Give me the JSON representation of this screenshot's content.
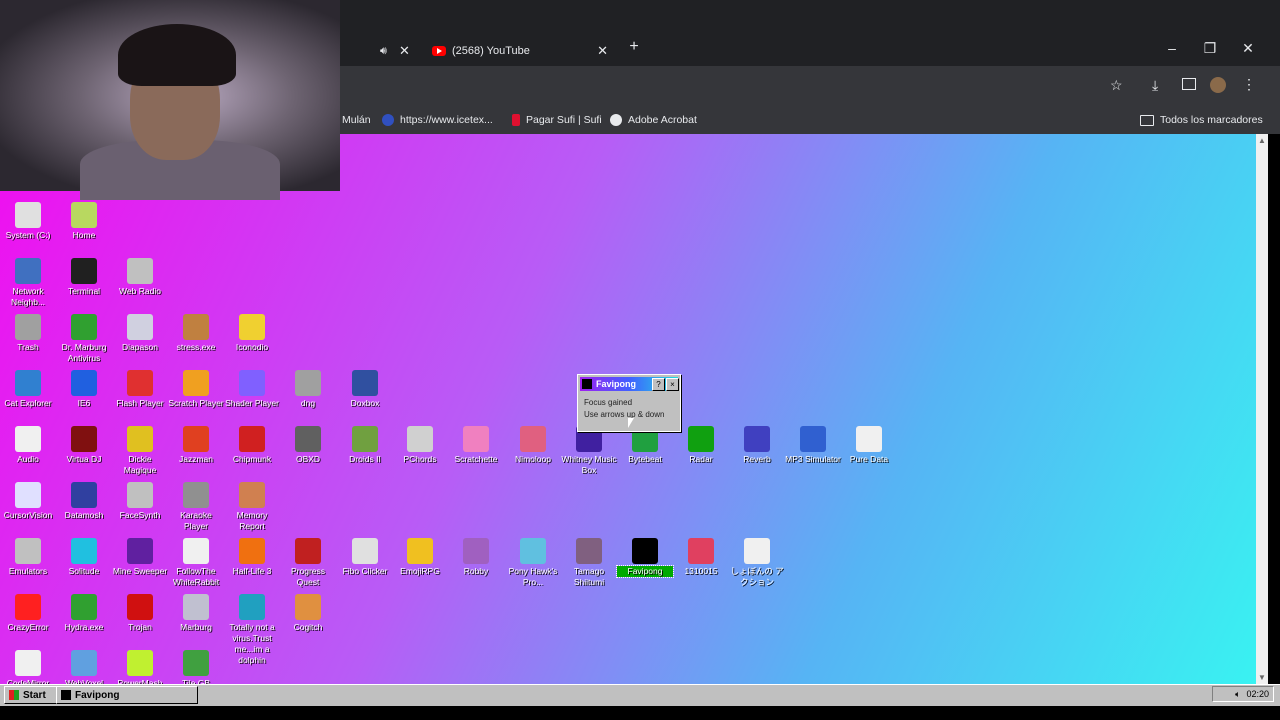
{
  "browser": {
    "tabs": [
      {
        "label": ""
      },
      {
        "label": "(2568) YouTube"
      }
    ],
    "new_tab_symbol": "+",
    "bookmarks": [
      {
        "label": "Mulán"
      },
      {
        "label": "https://www.icetex..."
      },
      {
        "label": "Pagar Sufi | Sufi"
      },
      {
        "label": "Adobe Acrobat"
      }
    ],
    "all_bookmarks_label": "Todos los marcadores"
  },
  "desktop": {
    "icons": [
      {
        "label": "System (C:)",
        "color": "#e0e0e0"
      },
      {
        "label": "Home",
        "color": "#b8d860"
      },
      {
        "label": "Network Neighb...",
        "color": "#4070c0"
      },
      {
        "label": "Terminal",
        "color": "#202020"
      },
      {
        "label": "Web Radio",
        "color": "#c0c0c0"
      },
      {
        "label": "Trash",
        "color": "#a0a0a0"
      },
      {
        "label": "Dr. Marburg Antivirus",
        "color": "#30a030"
      },
      {
        "label": "Diapason",
        "color": "#d0d0e0"
      },
      {
        "label": "stress.exe",
        "color": "#c08040"
      },
      {
        "label": "Iconodio",
        "color": "#f0d030"
      },
      {
        "label": "Cat Explorer",
        "color": "#3080d0"
      },
      {
        "label": "IE6",
        "color": "#2060e0"
      },
      {
        "label": "Flash Player",
        "color": "#e03030"
      },
      {
        "label": "Scratch Player",
        "color": "#f0a020"
      },
      {
        "label": "Shader Player",
        "color": "#8060ff"
      },
      {
        "label": "dng",
        "color": "#a0a0a0"
      },
      {
        "label": "Doxbox",
        "color": "#3050a0"
      },
      {
        "label": "Audio",
        "color": "#f0f0f0"
      },
      {
        "label": "Virtua DJ",
        "color": "#801010"
      },
      {
        "label": "Dickie Magique",
        "color": "#e0c020"
      },
      {
        "label": "Jazzman",
        "color": "#e04020"
      },
      {
        "label": "Chipmunk",
        "color": "#d02020"
      },
      {
        "label": "OBXD",
        "color": "#606060"
      },
      {
        "label": "Droids II",
        "color": "#70a040"
      },
      {
        "label": "PChords",
        "color": "#d0d0d0"
      },
      {
        "label": "Scratchette",
        "color": "#f080c0"
      },
      {
        "label": "Nimoloop",
        "color": "#e06080"
      },
      {
        "label": "Whitney Music Box",
        "color": "#4020a0"
      },
      {
        "label": "Bytebeat",
        "color": "#20a040"
      },
      {
        "label": "Radar",
        "color": "#10a010"
      },
      {
        "label": "Reverb",
        "color": "#4040c0"
      },
      {
        "label": "MP3 Simulator",
        "color": "#3060d0"
      },
      {
        "label": "Pure Data",
        "color": "#f0f0f0"
      },
      {
        "label": "CursorVision",
        "color": "#e0e0ff"
      },
      {
        "label": "Datamosh",
        "color": "#3040a0"
      },
      {
        "label": "FaceSynth",
        "color": "#c0c0c0"
      },
      {
        "label": "Karaoke Player",
        "color": "#909090"
      },
      {
        "label": "Memory Report",
        "color": "#d08050"
      },
      {
        "label": "Emulators",
        "color": "#c0c0c0"
      },
      {
        "label": "Solitude",
        "color": "#20c0e0"
      },
      {
        "label": "Mine Sweeper",
        "color": "#6020a0"
      },
      {
        "label": "FollowThe WhiteRabbit",
        "color": "#f0f0f0"
      },
      {
        "label": "Half-Life 3",
        "color": "#f07010"
      },
      {
        "label": "Progress Quest",
        "color": "#c02020"
      },
      {
        "label": "Fibo Clicker",
        "color": "#e0e0e0"
      },
      {
        "label": "EmojiRPG",
        "color": "#f0c020"
      },
      {
        "label": "Robby",
        "color": "#a060c0"
      },
      {
        "label": "Pony Hawk's Pro...",
        "color": "#60c0e0"
      },
      {
        "label": "Tamago Shiitumi",
        "color": "#806080"
      },
      {
        "label": "Favipong",
        "color": "#000000"
      },
      {
        "label": "1310015",
        "color": "#e04060"
      },
      {
        "label": "しょぼんの アクション",
        "color": "#f0f0f0"
      },
      {
        "label": "CrazyError",
        "color": "#ff2020"
      },
      {
        "label": "Hydra.exe",
        "color": "#30a030"
      },
      {
        "label": "Trojan",
        "color": "#d01010"
      },
      {
        "label": "Marburg",
        "color": "#c0c0d0"
      },
      {
        "label": "Totally not a virus.Trust me...im a dolphin",
        "color": "#20a0c0"
      },
      {
        "label": "Cogitch",
        "color": "#e09040"
      },
      {
        "label": "CodeMirror",
        "color": "#f0f0f0"
      },
      {
        "label": "WebVoxel",
        "color": "#60a0e0"
      },
      {
        "label": "PowerMash",
        "color": "#c0f030"
      },
      {
        "label": "Tile GB",
        "color": "#40a040"
      }
    ]
  },
  "dialog": {
    "title": "Favipong",
    "help_symbol": "?",
    "close_symbol": "×",
    "line1": "Focus gained",
    "line2": "Use arrows up & down"
  },
  "taskbar": {
    "start_label": "Start",
    "task_label": "Favipong",
    "clock": "02:20"
  }
}
